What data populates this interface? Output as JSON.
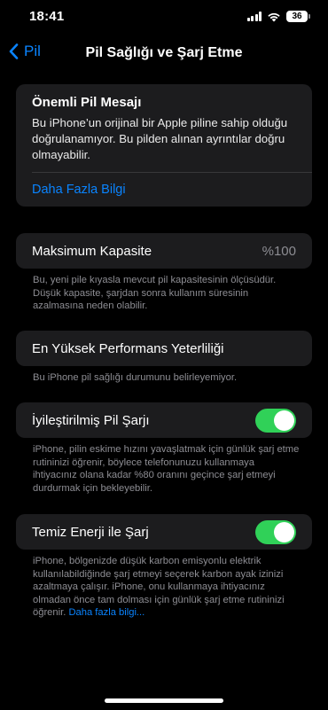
{
  "status": {
    "time": "18:41",
    "battery": "36"
  },
  "nav": {
    "back_label": "Pil",
    "title": "Pil Sağlığı ve Şarj Etme"
  },
  "message": {
    "title": "Önemli Pil Mesajı",
    "body": "Bu iPhone’un orijinal bir Apple piline sahip olduğu doğrulanamıyor. Bu pilden alınan ayrıntılar doğru olmayabilir.",
    "link": "Daha Fazla Bilgi"
  },
  "capacity": {
    "label": "Maksimum Kapasite",
    "value": "%100",
    "footnote": "Bu, yeni pile kıyasla mevcut pil kapasitesinin ölçüsüdür. Düşük kapasite, şarjdan sonra kullanım süresinin azalmasına neden olabilir."
  },
  "performance": {
    "label": "En Yüksek Performans Yeterliliği",
    "footnote": "Bu iPhone pil sağlığı durumunu belirleyemiyor."
  },
  "optimized": {
    "label": "İyileştirilmiş Pil Şarjı",
    "enabled": true,
    "footnote": "iPhone, pilin eskime hızını yavaşlatmak için günlük şarj etme rutininizi öğrenir, böylece telefonunuzu kullanmaya ihtiyacınız olana kadar %80 oranını geçince şarj etmeyi durdurmak için bekleyebilir."
  },
  "clean_energy": {
    "label": "Temiz Enerji ile Şarj",
    "enabled": true,
    "footnote": "iPhone, bölgenizde düşük karbon emisyonlu elektrik kullanılabildiğinde şarj etmeyi seçerek karbon ayak izinizi azaltmaya çalışır. iPhone, onu kullanmaya ihtiyacınız olmadan önce tam dolması için günlük şarj etme rutininizi öğrenir.",
    "link": "Daha fazla bilgi..."
  }
}
